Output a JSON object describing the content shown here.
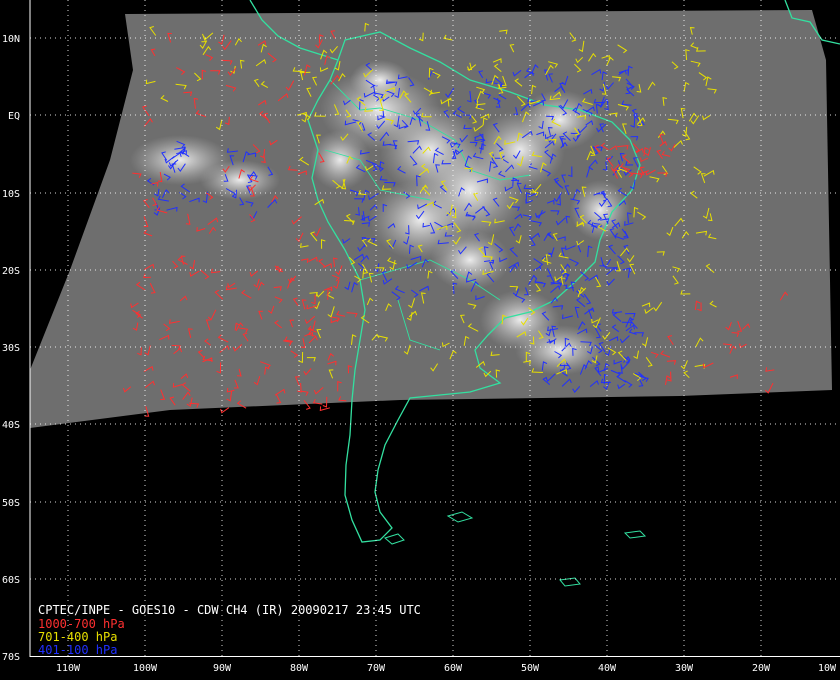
{
  "title": "CPTEC/INPE - GOES10 - CDW CH4 (IR) 20090217 23:45 UTC",
  "legend": [
    {
      "label": "1000-700 hPa",
      "color": "#ff3030"
    },
    {
      "label": "701-400 hPa",
      "color": "#e8e000"
    },
    {
      "label": "401-100 hPa",
      "color": "#2030ff"
    }
  ],
  "lat_labels": [
    "10N",
    "EQ",
    "10S",
    "20S",
    "30S",
    "40S",
    "50S",
    "60S",
    "70S"
  ],
  "lon_labels": [
    "110W",
    "100W",
    "90W",
    "80W",
    "70W",
    "60W",
    "50W",
    "40W",
    "30W",
    "20W",
    "10W"
  ],
  "colors": {
    "background": "#000000",
    "coastline": "#33e0a0",
    "satellite_gray": "#6e6e6e",
    "grid": "#ffffff"
  }
}
